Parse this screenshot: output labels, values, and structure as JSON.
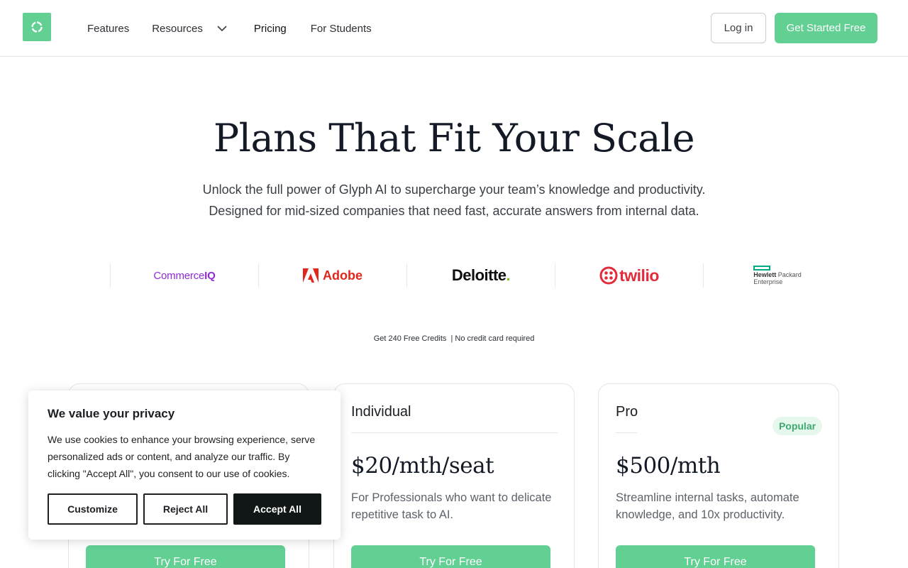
{
  "header": {
    "nav": {
      "features": "Features",
      "resources": "Resources",
      "pricing": "Pricing",
      "students": "For Students"
    },
    "login_label": "Log in",
    "cta_label": "Get Started Free"
  },
  "hero": {
    "title": "Plans That Fit Your Scale",
    "subtitle_line1": "Unlock the full power of Glyph AI to supercharge your team’s knowledge and productivity.",
    "subtitle_line2": "Designed for mid-sized companies that need fast, accurate answers from internal data."
  },
  "logos": {
    "commerceiq_a": "Commerce",
    "commerceiq_b": "IQ",
    "adobe": "Adobe",
    "deloitte": "Deloitte",
    "deloitte_dot": ".",
    "twilio": "twilio",
    "hpe_a": "Hewlett",
    "hpe_b": "Packard",
    "hpe_c": "Enterprise"
  },
  "credits_note": "Get 240 Free Credits  | No credit card required",
  "plans": [
    {
      "name": "Individual",
      "price": "$20/mth/seat",
      "description": "For Professionals who want to delicate repetitive task to AI.",
      "button": "Try For Free"
    },
    {
      "name": "Pro",
      "badge": "Popular",
      "price": "$500/mth",
      "description": "Streamline internal tasks, automate knowledge, and 10x productivity.",
      "button": "Try For Free"
    }
  ],
  "free_plan_button": "Try For Free",
  "cookie": {
    "title": "We value your privacy",
    "text": "We use cookies to enhance your browsing experience, serve personalized ads or content, and analyze our traffic. By clicking \"Accept All\", you consent to our use of cookies.",
    "customize": "Customize",
    "reject": "Reject All",
    "accept": "Accept All"
  },
  "colors": {
    "brand_green": "#62cf93",
    "badge_bg": "#e6f8ee",
    "badge_text": "#3fa86f",
    "dark_button": "#111716"
  },
  "icons": {
    "logo": "circle-ring-icon",
    "resources_dropdown": "chevron-down-icon"
  }
}
